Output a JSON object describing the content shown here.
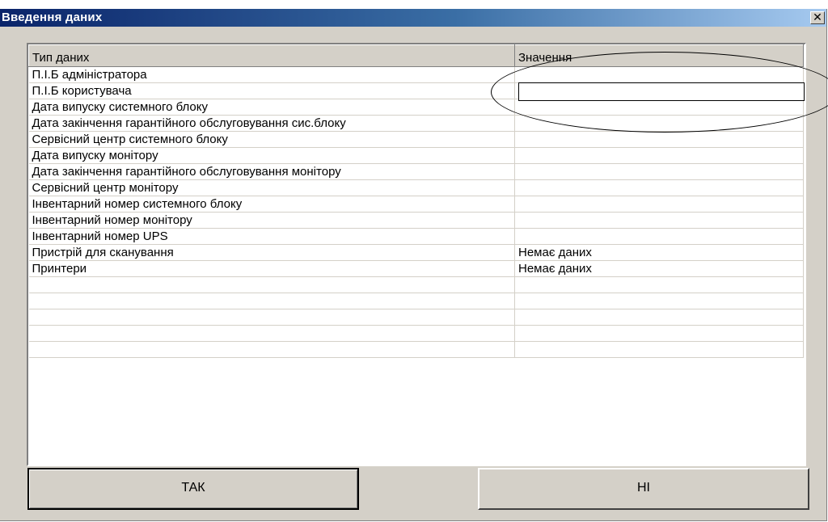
{
  "window": {
    "title": "Введення даних",
    "close_label": "x"
  },
  "grid": {
    "columns": [
      "Тип даних",
      "Значення"
    ],
    "rows": [
      {
        "type": "П.І.Б адміністратора",
        "value": ""
      },
      {
        "type": "П.І.Б користувача",
        "value": ""
      },
      {
        "type": "Дата випуску системного блоку",
        "value": ""
      },
      {
        "type": "Дата закінчення гарантійного обслуговування сис.блоку",
        "value": ""
      },
      {
        "type": "Сервісний центр системного блоку",
        "value": ""
      },
      {
        "type": "Дата випуску монітору",
        "value": ""
      },
      {
        "type": "Дата закінчення гарантійного обслуговування монітору",
        "value": ""
      },
      {
        "type": "Сервісний центр монітору",
        "value": ""
      },
      {
        "type": "Інвентарний номер системного блоку",
        "value": ""
      },
      {
        "type": "Інвентарний номер монітору",
        "value": ""
      },
      {
        "type": "Інвентарний номер UPS",
        "value": ""
      },
      {
        "type": "Пристрій для сканування",
        "value": "Немає даних"
      },
      {
        "type": "Принтери",
        "value": "Немає даних"
      },
      {
        "type": "",
        "value": ""
      },
      {
        "type": "",
        "value": ""
      },
      {
        "type": "",
        "value": ""
      },
      {
        "type": "",
        "value": ""
      },
      {
        "type": "",
        "value": ""
      }
    ]
  },
  "buttons": {
    "yes_label": "ТАК",
    "no_label": "НІ"
  }
}
